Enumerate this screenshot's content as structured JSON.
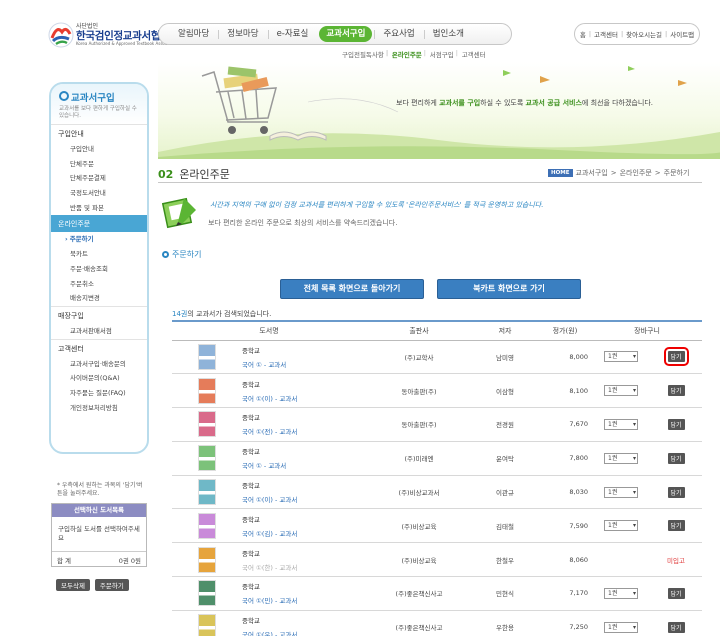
{
  "header": {
    "logo_small": "사단법인",
    "logo_name": "한국검인정교과서협회",
    "logo_eng": "Korea Authorized & Approved Textbook Association",
    "gnb": [
      "알림마당",
      "정보마당",
      "e-자료실",
      "교과서구입",
      "주요사업",
      "법인소개"
    ],
    "gnb_active": "교과서구입",
    "util": [
      "홈",
      "고객센터",
      "찾아오시는길",
      "사이트맵"
    ],
    "subnav": [
      "구입전필독사항",
      "온라인주문",
      "서점구입",
      "고객센터"
    ]
  },
  "banner": {
    "slogan_pre": "보다 편리하게 ",
    "slogan_hl1": "교과서를 구입",
    "slogan_mid": "하실 수 있도록 ",
    "slogan_hl2": "교과서 공급 서비스",
    "slogan_post": "에 최선을 다하겠습니다."
  },
  "sidebar": {
    "title": "교과서구입",
    "desc": "교과서를 보다 편하게 구입하실 수 있습니다.",
    "sections": [
      {
        "label": "구입안내",
        "items": [
          "구입안내",
          "단체주문",
          "단체주문결제",
          "국정도서안내",
          "반품 및 파본"
        ]
      },
      {
        "label": "온라인주문",
        "items": [
          "주문하기",
          "북카트",
          "주문·배송조회",
          "주문취소",
          "배송지변경"
        ]
      },
      {
        "label": "매장구입",
        "items": [
          "교과서판매서점"
        ]
      },
      {
        "label": "고객센터",
        "items": [
          "교과서구입·배송문의",
          "사이버문의(Q&A)",
          "자주묻는 질문(FAQ)",
          "개인정보처리방침"
        ]
      }
    ],
    "active_item": "주문하기",
    "note": "* 우측에서 원하는 과목의 '담기'버튼을 눌러주세요.",
    "cart_title": "선택하신 도서목록",
    "cart_empty": "구입하실 도서를 선택하여주세요",
    "cart_total_label": "합 계",
    "cart_total_value": "0권 0원",
    "btn_delete": "모두삭제",
    "btn_order": "주문하기"
  },
  "content": {
    "num": "02",
    "title": "온라인주문",
    "breadcrumb": [
      "HOME",
      "교과서구입",
      "온라인주문",
      "주문하기"
    ],
    "intro1": "시간과 지역의 구애 없이 검정 교과서를 편리하게 구입할 수 있도록 '온라인주문서비스' 를 적극 운영하고 있습니다.",
    "intro2": "보다 편리한 온라인 주문으로 최상의 서비스를 약속드리겠습니다.",
    "section": "주문하기",
    "btn_list": "전체 목록 화면으로 돌아가기",
    "btn_cart": "북카트 화면으로 가기",
    "count_num": "14권",
    "count_text": "의 교과서가 검색되었습니다."
  },
  "table": {
    "headers": [
      "도서명",
      "출판사",
      "저자",
      "정가(원)",
      "장바구니"
    ],
    "rows": [
      {
        "level": "중학교",
        "name": "국어 ① - 교과서",
        "publisher": "(주)교학사",
        "author": "남미영",
        "price": "8,000",
        "qty": "1권",
        "action": "담기",
        "status": "",
        "thumb": "#8fb3d9"
      },
      {
        "level": "중학교",
        "name": "국어 ①(이) - 교과서",
        "publisher": "동아출판(주)",
        "author": "이삼형",
        "price": "8,100",
        "qty": "1권",
        "action": "담기",
        "status": "",
        "thumb": "#e57c5a"
      },
      {
        "level": "중학교",
        "name": "국어 ①(전) - 교과서",
        "publisher": "동아출판(주)",
        "author": "전경원",
        "price": "7,670",
        "qty": "1권",
        "action": "담기",
        "status": "",
        "thumb": "#d96a8a"
      },
      {
        "level": "중학교",
        "name": "국어 ① - 교과서",
        "publisher": "(주)미래엔",
        "author": "윤여탁",
        "price": "7,800",
        "qty": "1권",
        "action": "담기",
        "status": "",
        "thumb": "#7cc27a"
      },
      {
        "level": "중학교",
        "name": "국어 ①(이) - 교과서",
        "publisher": "(주)비상교과서",
        "author": "이관규",
        "price": "8,030",
        "qty": "1권",
        "action": "담기",
        "status": "",
        "thumb": "#6fb8c7"
      },
      {
        "level": "중학교",
        "name": "국어 ①(김) - 교과서",
        "publisher": "(주)비상교육",
        "author": "김태철",
        "price": "7,590",
        "qty": "1권",
        "action": "담기",
        "status": "",
        "thumb": "#c98ad9"
      },
      {
        "level": "중학교",
        "name": "국어 ①(한) - 교과서",
        "publisher": "(주)비상교육",
        "author": "한철우",
        "price": "8,060",
        "qty": "",
        "action": "",
        "status": "미입고",
        "thumb": "#e6a43c"
      },
      {
        "level": "중학교",
        "name": "국어 ①(민) - 교과서",
        "publisher": "(주)좋은책신사고",
        "author": "민현식",
        "price": "7,170",
        "qty": "1권",
        "action": "담기",
        "status": "",
        "thumb": "#4f8f6a"
      },
      {
        "level": "중학교",
        "name": "국어 ①(우) - 교과서",
        "publisher": "(주)좋은책신사고",
        "author": "우한용",
        "price": "7,250",
        "qty": "1권",
        "action": "담기",
        "status": "",
        "thumb": "#d9c45a"
      }
    ]
  },
  "colors": {
    "accent_green": "#5bb534",
    "accent_blue": "#2a86c2",
    "button_blue": "#3a7fc1",
    "highlight_red": "#e00000"
  }
}
